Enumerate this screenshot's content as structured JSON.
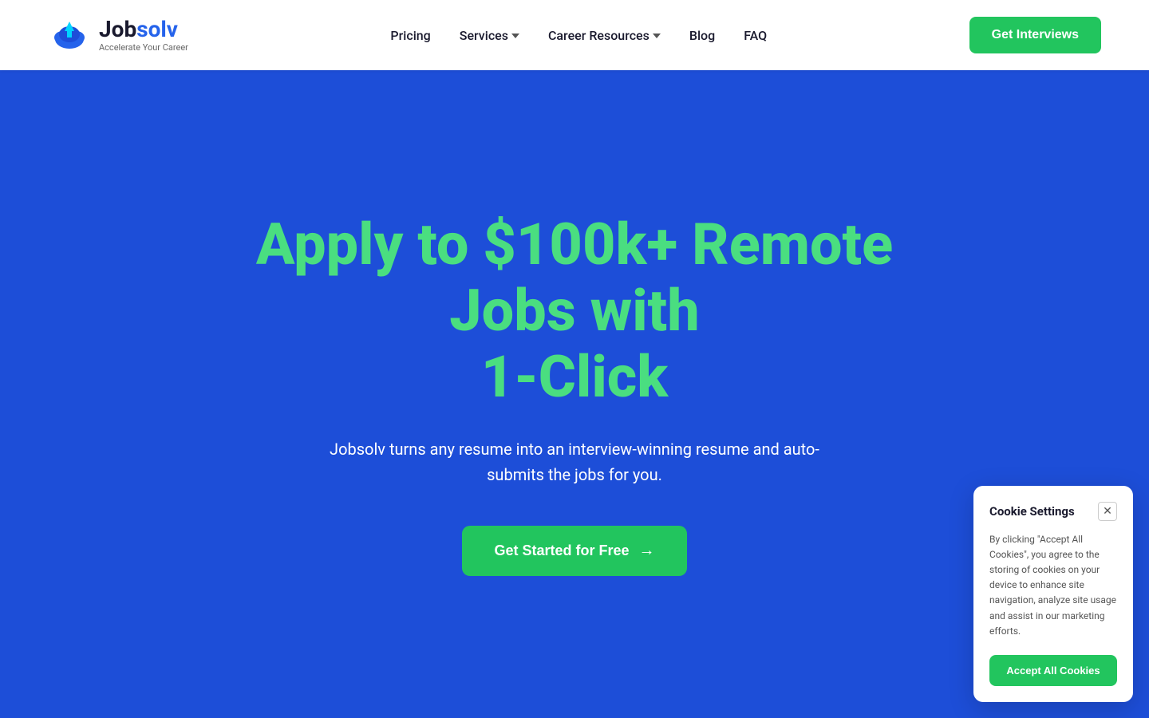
{
  "brand": {
    "name_part1": "Job",
    "name_part2": "solv",
    "tagline": "Accelerate Your Career"
  },
  "navbar": {
    "links": [
      {
        "label": "Pricing",
        "has_dropdown": false
      },
      {
        "label": "Services",
        "has_dropdown": true
      },
      {
        "label": "Career Resources",
        "has_dropdown": true
      },
      {
        "label": "Blog",
        "has_dropdown": false
      },
      {
        "label": "FAQ",
        "has_dropdown": false
      }
    ],
    "cta_label": "Get Interviews"
  },
  "hero": {
    "title_line1": "Apply to $100k+ Remote Jobs with",
    "title_line2": "1-Click",
    "subtitle": "Jobsolv turns any resume into an interview-winning resume and auto-submits the jobs for you.",
    "cta_label": "Get Started for Free"
  },
  "cookie": {
    "title": "Cookie Settings",
    "body": "By clicking \"Accept All Cookies\", you agree to the storing of cookies on your device to enhance site navigation, analyze site usage and assist in our marketing efforts.",
    "accept_label": "Accept All Cookies"
  }
}
